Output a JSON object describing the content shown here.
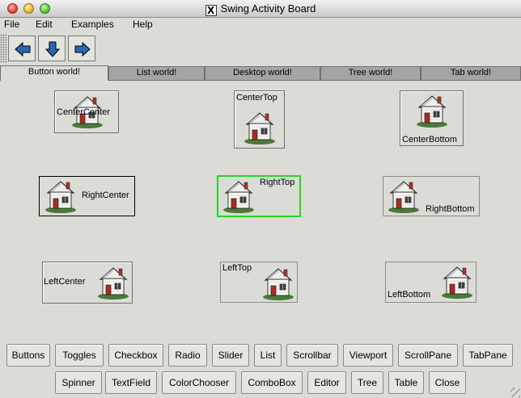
{
  "window": {
    "title": "Swing Activity Board",
    "title_icon": "X"
  },
  "menu": [
    "File",
    "Edit",
    "Examples",
    "Help"
  ],
  "toolbar": {
    "icons": [
      "arrow-left-icon",
      "arrow-down-icon",
      "arrow-right-icon"
    ]
  },
  "tabs": [
    "Button world!",
    "List world!",
    "Desktop world!",
    "Tree world!",
    "Tab world!"
  ],
  "active_tab": "Button world!",
  "house_buttons": [
    "CenterCenter",
    "CenterTop",
    "CenterBottom",
    "RightCenter",
    "RightTop",
    "RightBottom",
    "LeftCenter",
    "LeftTop",
    "LeftBottom"
  ],
  "bottom_row1": [
    "Buttons",
    "Toggles",
    "Checkbox",
    "Radio",
    "Slider",
    "List",
    "Scrollbar",
    "Viewport",
    "ScrollPane",
    "TabPane"
  ],
  "bottom_row2": [
    "Spinner",
    "TextField",
    "ColorChooser",
    "ComboBox",
    "Editor",
    "Tree",
    "Table",
    "Close"
  ],
  "colors": {
    "focus": "#22d622",
    "tab_inactive": "#a4a4a4",
    "background": "#dcdcd6"
  }
}
